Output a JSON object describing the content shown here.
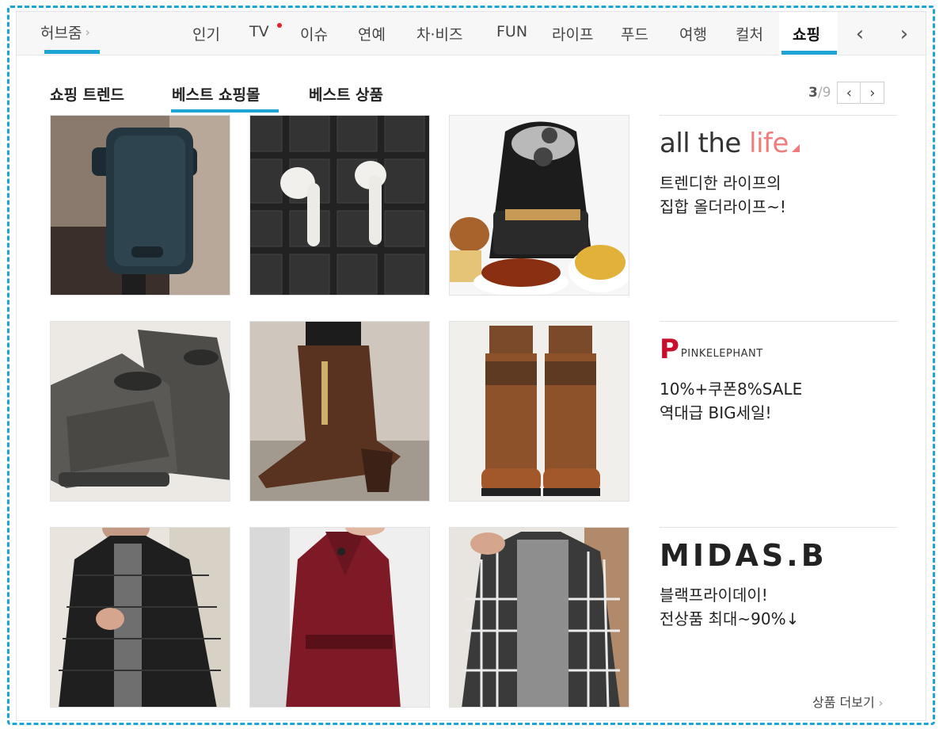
{
  "nav": {
    "hub_label": "허브줌",
    "tabs": [
      "인기",
      "TV",
      "이슈",
      "연예",
      "차·비즈",
      "FUN",
      "라이프",
      "푸드",
      "여행",
      "컬처",
      "쇼핑"
    ],
    "active_tab": "쇼핑",
    "prev_symbol": "‹",
    "next_symbol": "›"
  },
  "subtabs": [
    "쇼핑 트렌드",
    "베스트 쇼핑몰",
    "베스트 상품"
  ],
  "active_subtab": "베스트 쇼핑몰",
  "pager": {
    "current": "3",
    "total": "/9",
    "prev_symbol": "‹",
    "next_symbol": "›"
  },
  "stores": [
    {
      "logo_text_a": "all the ",
      "logo_text_b": "life",
      "line1": "트렌디한 라이프의",
      "line2": "집합 올더라이프~!"
    },
    {
      "logo_mark": "P",
      "logo_word": "PINKELEPHANT",
      "line1": "10%+쿠폰8%SALE",
      "line2": "역대급 BIG세일!"
    },
    {
      "logo_text": "MIDAS.B",
      "line1": "블랙프라이데이!",
      "line2": "전상품 최대~90%↓"
    }
  ],
  "more_label": "상품 더보기",
  "colors": {
    "accent": "#1fa4d6",
    "red_dot": "#e8202a",
    "pink": "#ef7c7c"
  },
  "icons": [
    "chevron-right-icon",
    "chevron-left-icon",
    "new-dot-icon"
  ]
}
